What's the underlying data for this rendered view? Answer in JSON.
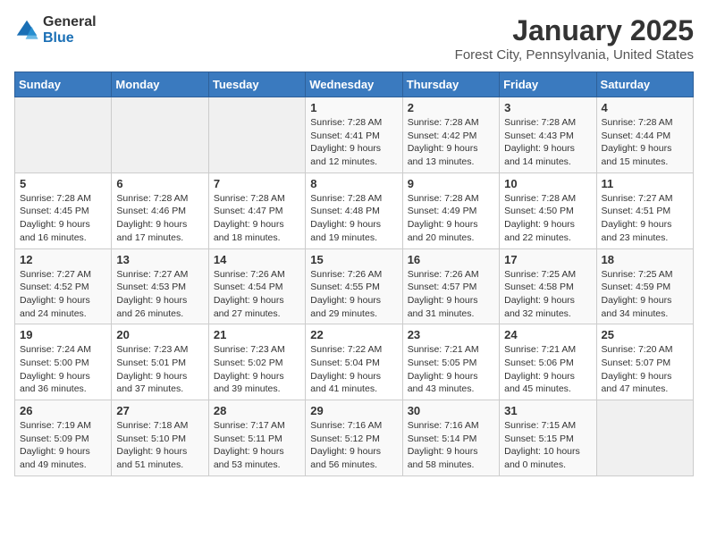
{
  "logo": {
    "general": "General",
    "blue": "Blue"
  },
  "header": {
    "title": "January 2025",
    "location": "Forest City, Pennsylvania, United States"
  },
  "weekdays": [
    "Sunday",
    "Monday",
    "Tuesday",
    "Wednesday",
    "Thursday",
    "Friday",
    "Saturday"
  ],
  "weeks": [
    [
      {
        "day": "",
        "info": ""
      },
      {
        "day": "",
        "info": ""
      },
      {
        "day": "",
        "info": ""
      },
      {
        "day": "1",
        "info": "Sunrise: 7:28 AM\nSunset: 4:41 PM\nDaylight: 9 hours\nand 12 minutes."
      },
      {
        "day": "2",
        "info": "Sunrise: 7:28 AM\nSunset: 4:42 PM\nDaylight: 9 hours\nand 13 minutes."
      },
      {
        "day": "3",
        "info": "Sunrise: 7:28 AM\nSunset: 4:43 PM\nDaylight: 9 hours\nand 14 minutes."
      },
      {
        "day": "4",
        "info": "Sunrise: 7:28 AM\nSunset: 4:44 PM\nDaylight: 9 hours\nand 15 minutes."
      }
    ],
    [
      {
        "day": "5",
        "info": "Sunrise: 7:28 AM\nSunset: 4:45 PM\nDaylight: 9 hours\nand 16 minutes."
      },
      {
        "day": "6",
        "info": "Sunrise: 7:28 AM\nSunset: 4:46 PM\nDaylight: 9 hours\nand 17 minutes."
      },
      {
        "day": "7",
        "info": "Sunrise: 7:28 AM\nSunset: 4:47 PM\nDaylight: 9 hours\nand 18 minutes."
      },
      {
        "day": "8",
        "info": "Sunrise: 7:28 AM\nSunset: 4:48 PM\nDaylight: 9 hours\nand 19 minutes."
      },
      {
        "day": "9",
        "info": "Sunrise: 7:28 AM\nSunset: 4:49 PM\nDaylight: 9 hours\nand 20 minutes."
      },
      {
        "day": "10",
        "info": "Sunrise: 7:28 AM\nSunset: 4:50 PM\nDaylight: 9 hours\nand 22 minutes."
      },
      {
        "day": "11",
        "info": "Sunrise: 7:27 AM\nSunset: 4:51 PM\nDaylight: 9 hours\nand 23 minutes."
      }
    ],
    [
      {
        "day": "12",
        "info": "Sunrise: 7:27 AM\nSunset: 4:52 PM\nDaylight: 9 hours\nand 24 minutes."
      },
      {
        "day": "13",
        "info": "Sunrise: 7:27 AM\nSunset: 4:53 PM\nDaylight: 9 hours\nand 26 minutes."
      },
      {
        "day": "14",
        "info": "Sunrise: 7:26 AM\nSunset: 4:54 PM\nDaylight: 9 hours\nand 27 minutes."
      },
      {
        "day": "15",
        "info": "Sunrise: 7:26 AM\nSunset: 4:55 PM\nDaylight: 9 hours\nand 29 minutes."
      },
      {
        "day": "16",
        "info": "Sunrise: 7:26 AM\nSunset: 4:57 PM\nDaylight: 9 hours\nand 31 minutes."
      },
      {
        "day": "17",
        "info": "Sunrise: 7:25 AM\nSunset: 4:58 PM\nDaylight: 9 hours\nand 32 minutes."
      },
      {
        "day": "18",
        "info": "Sunrise: 7:25 AM\nSunset: 4:59 PM\nDaylight: 9 hours\nand 34 minutes."
      }
    ],
    [
      {
        "day": "19",
        "info": "Sunrise: 7:24 AM\nSunset: 5:00 PM\nDaylight: 9 hours\nand 36 minutes."
      },
      {
        "day": "20",
        "info": "Sunrise: 7:23 AM\nSunset: 5:01 PM\nDaylight: 9 hours\nand 37 minutes."
      },
      {
        "day": "21",
        "info": "Sunrise: 7:23 AM\nSunset: 5:02 PM\nDaylight: 9 hours\nand 39 minutes."
      },
      {
        "day": "22",
        "info": "Sunrise: 7:22 AM\nSunset: 5:04 PM\nDaylight: 9 hours\nand 41 minutes."
      },
      {
        "day": "23",
        "info": "Sunrise: 7:21 AM\nSunset: 5:05 PM\nDaylight: 9 hours\nand 43 minutes."
      },
      {
        "day": "24",
        "info": "Sunrise: 7:21 AM\nSunset: 5:06 PM\nDaylight: 9 hours\nand 45 minutes."
      },
      {
        "day": "25",
        "info": "Sunrise: 7:20 AM\nSunset: 5:07 PM\nDaylight: 9 hours\nand 47 minutes."
      }
    ],
    [
      {
        "day": "26",
        "info": "Sunrise: 7:19 AM\nSunset: 5:09 PM\nDaylight: 9 hours\nand 49 minutes."
      },
      {
        "day": "27",
        "info": "Sunrise: 7:18 AM\nSunset: 5:10 PM\nDaylight: 9 hours\nand 51 minutes."
      },
      {
        "day": "28",
        "info": "Sunrise: 7:17 AM\nSunset: 5:11 PM\nDaylight: 9 hours\nand 53 minutes."
      },
      {
        "day": "29",
        "info": "Sunrise: 7:16 AM\nSunset: 5:12 PM\nDaylight: 9 hours\nand 56 minutes."
      },
      {
        "day": "30",
        "info": "Sunrise: 7:16 AM\nSunset: 5:14 PM\nDaylight: 9 hours\nand 58 minutes."
      },
      {
        "day": "31",
        "info": "Sunrise: 7:15 AM\nSunset: 5:15 PM\nDaylight: 10 hours\nand 0 minutes."
      },
      {
        "day": "",
        "info": ""
      }
    ]
  ]
}
